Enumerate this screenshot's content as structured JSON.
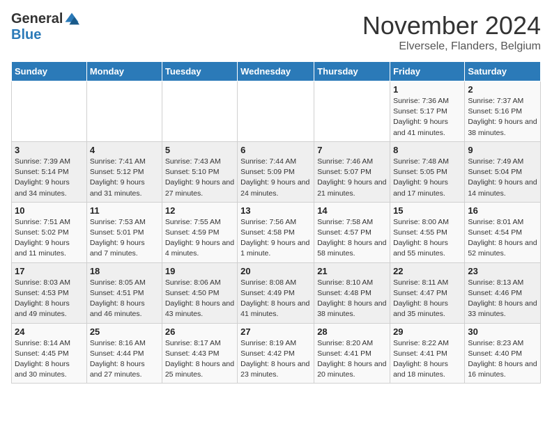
{
  "logo": {
    "general": "General",
    "blue": "Blue"
  },
  "title": "November 2024",
  "subtitle": "Elversele, Flanders, Belgium",
  "weekdays": [
    "Sunday",
    "Monday",
    "Tuesday",
    "Wednesday",
    "Thursday",
    "Friday",
    "Saturday"
  ],
  "weeks": [
    [
      {
        "day": "",
        "info": ""
      },
      {
        "day": "",
        "info": ""
      },
      {
        "day": "",
        "info": ""
      },
      {
        "day": "",
        "info": ""
      },
      {
        "day": "",
        "info": ""
      },
      {
        "day": "1",
        "info": "Sunrise: 7:36 AM\nSunset: 5:17 PM\nDaylight: 9 hours and 41 minutes."
      },
      {
        "day": "2",
        "info": "Sunrise: 7:37 AM\nSunset: 5:16 PM\nDaylight: 9 hours and 38 minutes."
      }
    ],
    [
      {
        "day": "3",
        "info": "Sunrise: 7:39 AM\nSunset: 5:14 PM\nDaylight: 9 hours and 34 minutes."
      },
      {
        "day": "4",
        "info": "Sunrise: 7:41 AM\nSunset: 5:12 PM\nDaylight: 9 hours and 31 minutes."
      },
      {
        "day": "5",
        "info": "Sunrise: 7:43 AM\nSunset: 5:10 PM\nDaylight: 9 hours and 27 minutes."
      },
      {
        "day": "6",
        "info": "Sunrise: 7:44 AM\nSunset: 5:09 PM\nDaylight: 9 hours and 24 minutes."
      },
      {
        "day": "7",
        "info": "Sunrise: 7:46 AM\nSunset: 5:07 PM\nDaylight: 9 hours and 21 minutes."
      },
      {
        "day": "8",
        "info": "Sunrise: 7:48 AM\nSunset: 5:05 PM\nDaylight: 9 hours and 17 minutes."
      },
      {
        "day": "9",
        "info": "Sunrise: 7:49 AM\nSunset: 5:04 PM\nDaylight: 9 hours and 14 minutes."
      }
    ],
    [
      {
        "day": "10",
        "info": "Sunrise: 7:51 AM\nSunset: 5:02 PM\nDaylight: 9 hours and 11 minutes."
      },
      {
        "day": "11",
        "info": "Sunrise: 7:53 AM\nSunset: 5:01 PM\nDaylight: 9 hours and 7 minutes."
      },
      {
        "day": "12",
        "info": "Sunrise: 7:55 AM\nSunset: 4:59 PM\nDaylight: 9 hours and 4 minutes."
      },
      {
        "day": "13",
        "info": "Sunrise: 7:56 AM\nSunset: 4:58 PM\nDaylight: 9 hours and 1 minute."
      },
      {
        "day": "14",
        "info": "Sunrise: 7:58 AM\nSunset: 4:57 PM\nDaylight: 8 hours and 58 minutes."
      },
      {
        "day": "15",
        "info": "Sunrise: 8:00 AM\nSunset: 4:55 PM\nDaylight: 8 hours and 55 minutes."
      },
      {
        "day": "16",
        "info": "Sunrise: 8:01 AM\nSunset: 4:54 PM\nDaylight: 8 hours and 52 minutes."
      }
    ],
    [
      {
        "day": "17",
        "info": "Sunrise: 8:03 AM\nSunset: 4:53 PM\nDaylight: 8 hours and 49 minutes."
      },
      {
        "day": "18",
        "info": "Sunrise: 8:05 AM\nSunset: 4:51 PM\nDaylight: 8 hours and 46 minutes."
      },
      {
        "day": "19",
        "info": "Sunrise: 8:06 AM\nSunset: 4:50 PM\nDaylight: 8 hours and 43 minutes."
      },
      {
        "day": "20",
        "info": "Sunrise: 8:08 AM\nSunset: 4:49 PM\nDaylight: 8 hours and 41 minutes."
      },
      {
        "day": "21",
        "info": "Sunrise: 8:10 AM\nSunset: 4:48 PM\nDaylight: 8 hours and 38 minutes."
      },
      {
        "day": "22",
        "info": "Sunrise: 8:11 AM\nSunset: 4:47 PM\nDaylight: 8 hours and 35 minutes."
      },
      {
        "day": "23",
        "info": "Sunrise: 8:13 AM\nSunset: 4:46 PM\nDaylight: 8 hours and 33 minutes."
      }
    ],
    [
      {
        "day": "24",
        "info": "Sunrise: 8:14 AM\nSunset: 4:45 PM\nDaylight: 8 hours and 30 minutes."
      },
      {
        "day": "25",
        "info": "Sunrise: 8:16 AM\nSunset: 4:44 PM\nDaylight: 8 hours and 27 minutes."
      },
      {
        "day": "26",
        "info": "Sunrise: 8:17 AM\nSunset: 4:43 PM\nDaylight: 8 hours and 25 minutes."
      },
      {
        "day": "27",
        "info": "Sunrise: 8:19 AM\nSunset: 4:42 PM\nDaylight: 8 hours and 23 minutes."
      },
      {
        "day": "28",
        "info": "Sunrise: 8:20 AM\nSunset: 4:41 PM\nDaylight: 8 hours and 20 minutes."
      },
      {
        "day": "29",
        "info": "Sunrise: 8:22 AM\nSunset: 4:41 PM\nDaylight: 8 hours and 18 minutes."
      },
      {
        "day": "30",
        "info": "Sunrise: 8:23 AM\nSunset: 4:40 PM\nDaylight: 8 hours and 16 minutes."
      }
    ]
  ]
}
